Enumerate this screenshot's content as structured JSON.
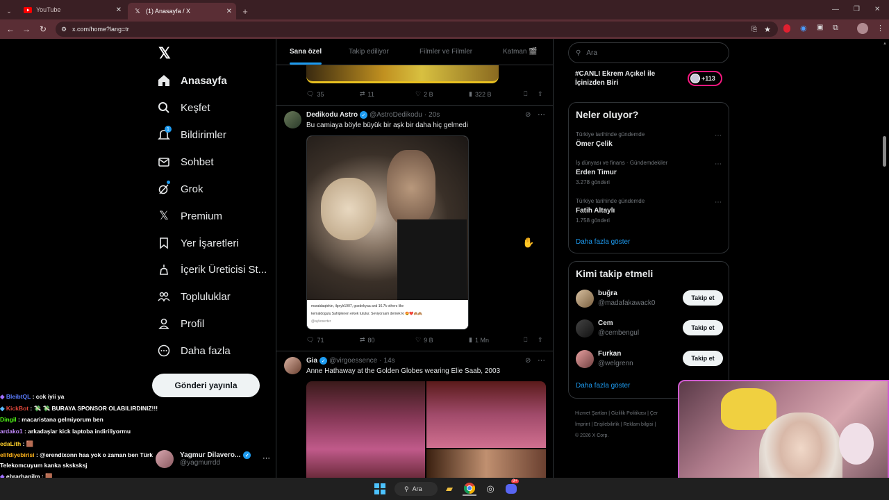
{
  "browser": {
    "tabs": [
      {
        "title": "YouTube",
        "icon": "youtube-icon"
      },
      {
        "title": "(1) Anasayfa / X",
        "icon": "x-icon"
      }
    ],
    "url": "x.com/home?lang=tr"
  },
  "sidebar": {
    "nav": [
      {
        "label": "Anasayfa",
        "icon": "home-icon"
      },
      {
        "label": "Keşfet",
        "icon": "search-icon"
      },
      {
        "label": "Bildirimler",
        "icon": "bell-icon",
        "badge": "1"
      },
      {
        "label": "Sohbet",
        "icon": "mail-icon"
      },
      {
        "label": "Grok",
        "icon": "grok-icon"
      },
      {
        "label": "Premium",
        "icon": "x-premium-icon"
      },
      {
        "label": "Yer İşaretleri",
        "icon": "bookmark-icon"
      },
      {
        "label": "İçerik Üreticisi St...",
        "icon": "creator-studio-icon"
      },
      {
        "label": "Topluluklar",
        "icon": "communities-icon"
      },
      {
        "label": "Profil",
        "icon": "profile-icon"
      },
      {
        "label": "Daha fazla",
        "icon": "more-icon"
      }
    ],
    "post_button": "Gönderi yayınla",
    "account": {
      "name": "Yagmur Dilavero...",
      "handle": "@yagmurrdd"
    }
  },
  "feed": {
    "tabs": [
      "Sana özel",
      "Takip ediliyor",
      "Filmler ve Filmler",
      "Katman 🎬"
    ],
    "top_actions": {
      "replies": "35",
      "reposts": "11",
      "likes": "2 B",
      "views": "322 B"
    },
    "tweets": [
      {
        "name": "Dedikodu Astro",
        "handle": "@AstroDedikodu",
        "time": "20s",
        "text": "Bu camiaya böyle büyük bir aşk bir daha hiç gelmedi",
        "image_caption_1": "muratdaqtekin, ilgnylr1907, gozdekyaa and 16.7k others like",
        "image_caption_2": "kemaldogulu Sahiplenen erkek tutulur. Seviyorsam demek ki 😍❤️🙈🙈",
        "image_caption_3": "@aykoserter",
        "replies": "71",
        "reposts": "80",
        "likes": "9 B",
        "views": "1 Mn"
      },
      {
        "name": "Gia",
        "handle": "@virgoessence",
        "time": "14s",
        "text": "Anne Hathaway at the Golden Globes wearing Elie Saab, 2003"
      }
    ]
  },
  "right": {
    "search_placeholder": "Ara",
    "live": {
      "title": "#CANLI Ekrem Açıkel ile İçinizden Biri",
      "count": "+113"
    },
    "trends_title": "Neler oluyor?",
    "trends": [
      {
        "category": "Türkiye tarihinde gündemde",
        "name": "Ömer Çelik",
        "count": ""
      },
      {
        "category": "İş dünyası ve finans · Gündemdekiler",
        "name": "Erden Timur",
        "count": "3.278 gönderi"
      },
      {
        "category": "Türkiye tarihinde gündemde",
        "name": "Fatih Altaylı",
        "count": "1.758 gönderi"
      }
    ],
    "show_more": "Daha fazla göster",
    "follow_title": "Kimi takip etmeli",
    "follow": [
      {
        "name": "buğra",
        "handle": "@madafakawack0",
        "button": "Takip et"
      },
      {
        "name": "Cem",
        "handle": "@cembengul",
        "button": "Takip et"
      },
      {
        "name": "Furkan",
        "handle": "@welgrenn",
        "button": "Takip et"
      }
    ],
    "footer_line1": "Hizmet Şartları | Gizlilik Politikası | Çer",
    "footer_line2": "İmprint | Erişilebilirlik | Reklam bilgisi |",
    "footer_line3": "© 2026 X Corp."
  },
  "chat": [
    {
      "user": "BleibtQL",
      "color": "#5b7cff",
      "msg": ": cok iyii ya"
    },
    {
      "user": "KickBot",
      "color": "#e0483b",
      "msg": ": 💸 💸 BURAYA SPONSOR OLABILIRDINIZ!!!"
    },
    {
      "user": "Dingil",
      "color": "#53fc18",
      "msg": ": macaristana gelmiyorum ben"
    },
    {
      "user": "ardako1",
      "color": "#c38bff",
      "msg": ": arkadaşlar kick laptoba indiriliyormu"
    },
    {
      "user": "edaLith",
      "color": "#ffd02b",
      "msg": ": 🟫"
    },
    {
      "user": "elifdiyebirisi",
      "color": "#ffb31a",
      "msg": ": @erendixonn haa yok o zaman ben Türk Telekomcuyum kanka sksksksj"
    },
    {
      "user": "ebrarhanilm",
      "color": "#ffffff",
      "msg": ": 🟫"
    }
  ],
  "taskbar": {
    "search": "Ara",
    "badge": "9+"
  }
}
